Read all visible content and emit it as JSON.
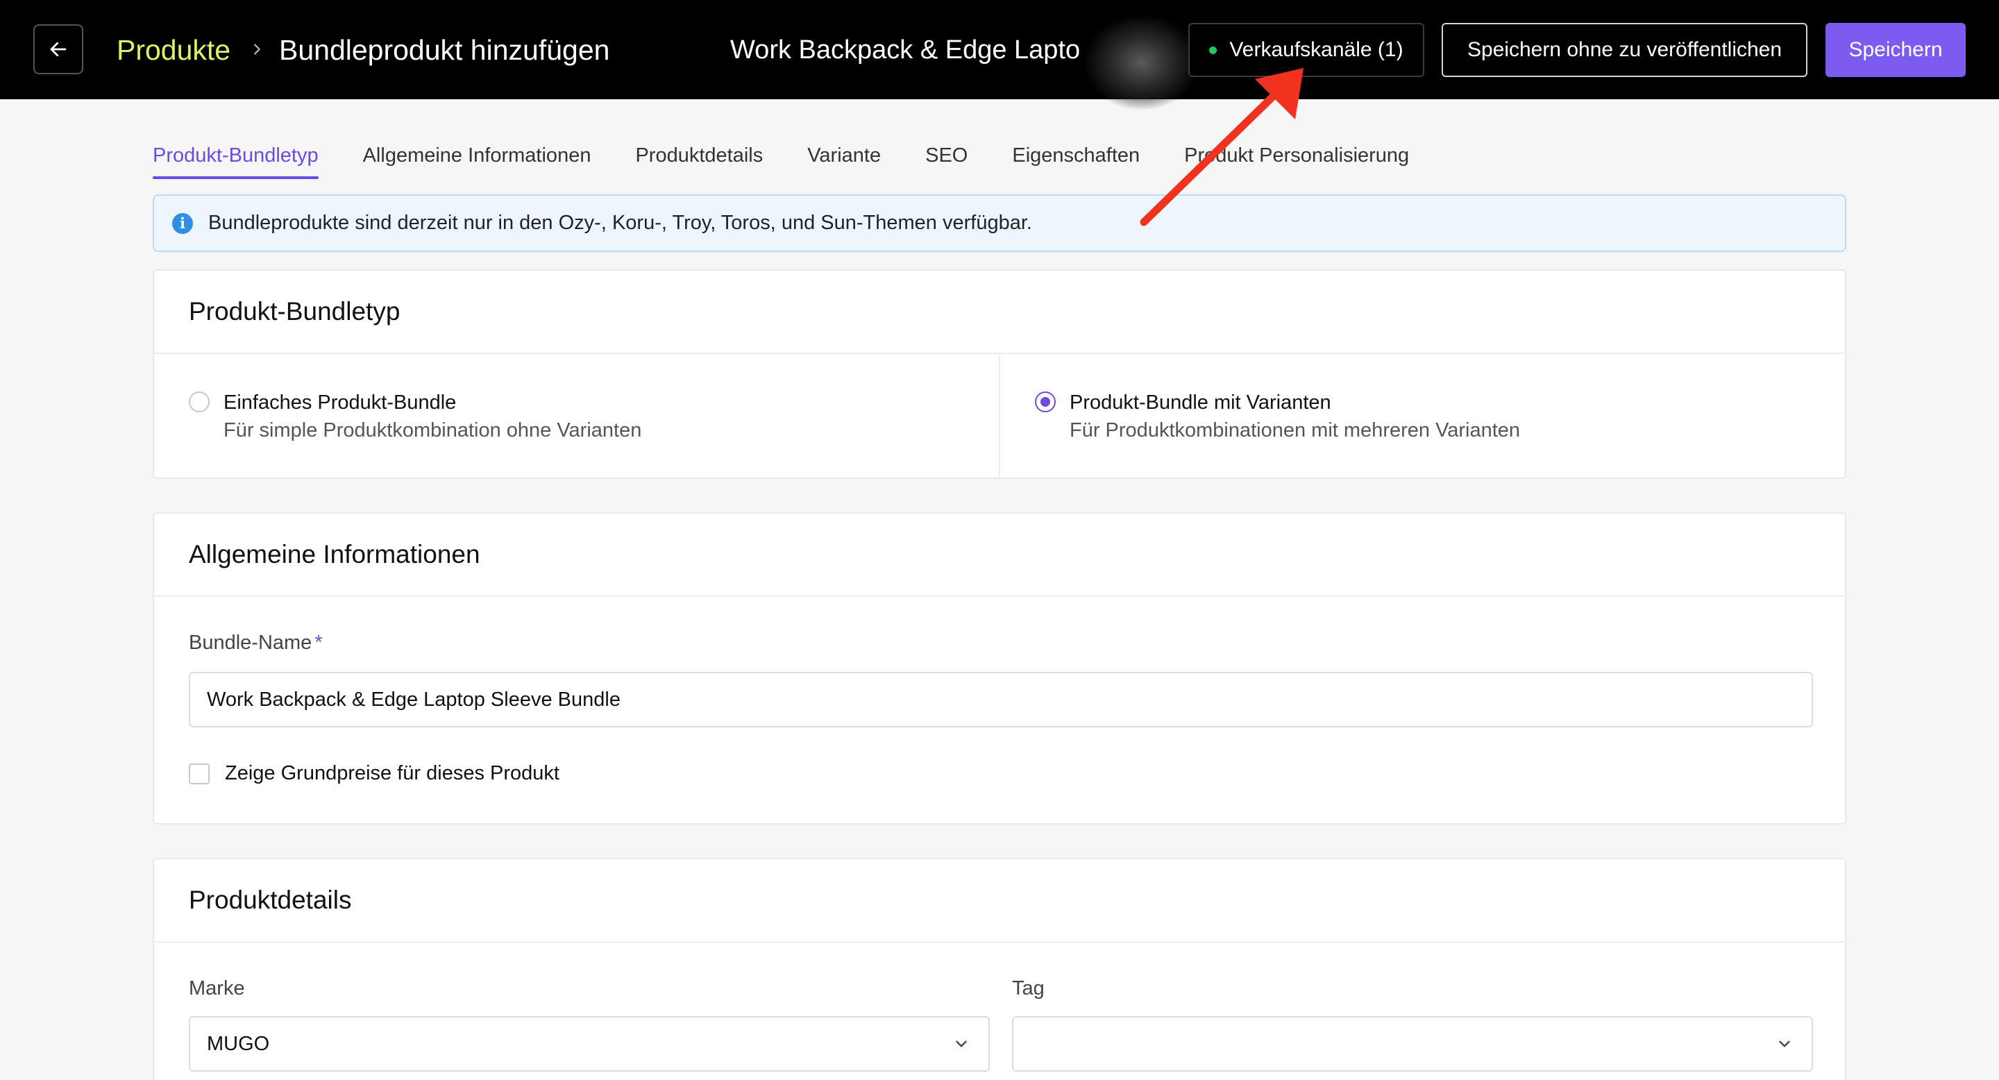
{
  "header": {
    "breadcrumb_root": "Produkte",
    "breadcrumb_current": "Bundleprodukt hinzufügen",
    "product_name": "Work Backpack & Edge Lapto",
    "channels_label": "Verkaufskanäle (1)",
    "save_draft_label": "Speichern ohne zu veröffentlichen",
    "save_label": "Speichern"
  },
  "tabs": [
    {
      "label": "Produkt-Bundletyp",
      "active": true
    },
    {
      "label": "Allgemeine Informationen"
    },
    {
      "label": "Produktdetails"
    },
    {
      "label": "Variante"
    },
    {
      "label": "SEO"
    },
    {
      "label": "Eigenschaften"
    },
    {
      "label": "Produkt Personalisierung"
    }
  ],
  "info_banner": {
    "text": "Bundleprodukte sind derzeit nur in den Ozy-, Koru-, Troy, Toros, und Sun-Themen verfügbar."
  },
  "bundle_type": {
    "title": "Produkt-Bundletyp",
    "options": [
      {
        "title": "Einfaches Produkt-Bundle",
        "description": "Für simple Produktkombination ohne Varianten",
        "selected": false
      },
      {
        "title": "Produkt-Bundle mit Varianten",
        "description": "Für Produktkombinationen mit mehreren Varianten",
        "selected": true
      }
    ]
  },
  "general_info": {
    "title": "Allgemeine Informationen",
    "name_label": "Bundle-Name",
    "required_mark": "*",
    "name_value": "Work Backpack & Edge Laptop Sleeve Bundle",
    "show_base_price_label": "Zeige Grundpreise für dieses Produkt"
  },
  "product_details": {
    "title": "Produktdetails",
    "brand_label": "Marke",
    "brand_value": "MUGO",
    "tag_label": "Tag",
    "tag_value": ""
  },
  "colors": {
    "accent": "#6d4ae8",
    "breadcrumb_root": "#e2f05e",
    "annotation_arrow": "#f0321e",
    "channel_status": "#22c55e"
  }
}
